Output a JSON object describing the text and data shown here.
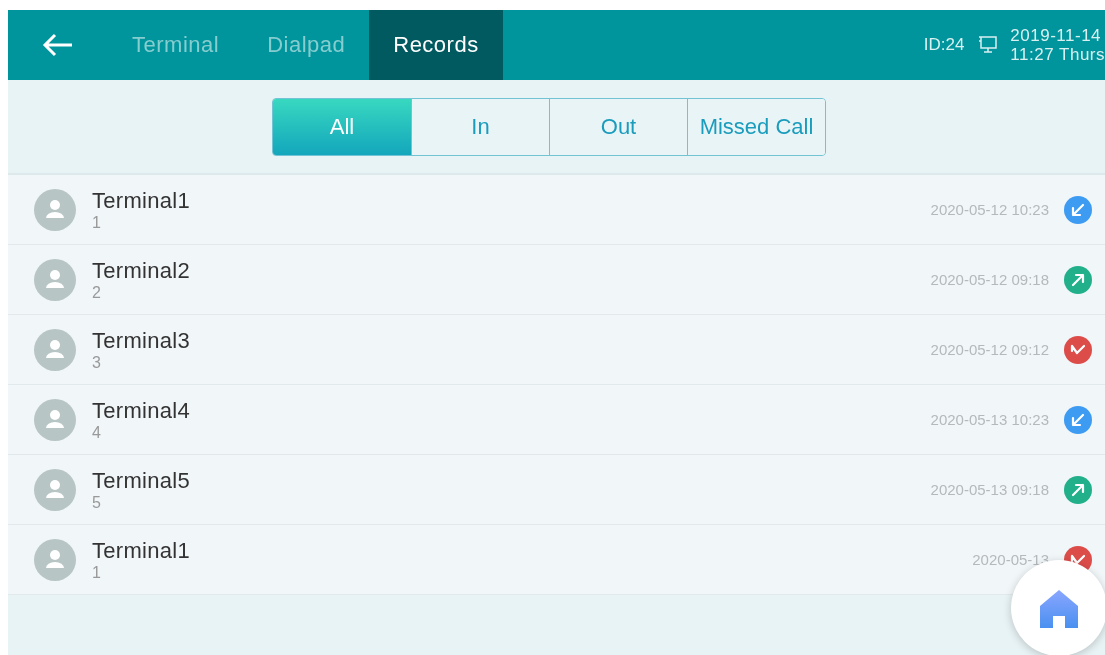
{
  "header": {
    "tabs": [
      {
        "label": "Terminal",
        "selected": false
      },
      {
        "label": "Dialpad",
        "selected": false
      },
      {
        "label": "Records",
        "selected": true
      }
    ],
    "device_id": "ID:24",
    "date": "2019-11-14",
    "time": "11:27 Thurs"
  },
  "filters": [
    {
      "label": "All",
      "selected": true
    },
    {
      "label": "In",
      "selected": false
    },
    {
      "label": "Out",
      "selected": false
    },
    {
      "label": "Missed Call",
      "selected": false
    }
  ],
  "records": [
    {
      "name": "Terminal1",
      "number": "1",
      "datetime": "2020-05-12 10:23",
      "kind": "in"
    },
    {
      "name": "Terminal2",
      "number": "2",
      "datetime": "2020-05-12 09:18",
      "kind": "out"
    },
    {
      "name": "Terminal3",
      "number": "3",
      "datetime": "2020-05-12 09:12",
      "kind": "missed"
    },
    {
      "name": "Terminal4",
      "number": "4",
      "datetime": "2020-05-13 10:23",
      "kind": "in"
    },
    {
      "name": "Terminal5",
      "number": "5",
      "datetime": "2020-05-13 09:18",
      "kind": "out"
    },
    {
      "name": "Terminal1",
      "number": "1",
      "datetime": "2020-05-13",
      "kind": "missed"
    }
  ]
}
